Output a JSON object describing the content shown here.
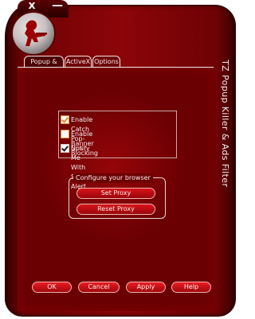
{
  "window": {
    "controls": {
      "close_symbol": "x",
      "minimize_symbol": "—"
    }
  },
  "app": {
    "vertical_title": "TZ Popup Killer & Ads Filter"
  },
  "tabs": [
    {
      "label": "Popup & Ads",
      "active": true
    },
    {
      "label": "ActiveX",
      "active": false
    },
    {
      "label": "Options",
      "active": false
    }
  ],
  "options": [
    {
      "label": "Enable Catch Pop-Ups",
      "checked": true,
      "check_style": "orange"
    },
    {
      "label": "Enable Banner Blocking",
      "checked": false,
      "check_style": "orange"
    },
    {
      "label": "Notify Me With Sound Alert",
      "checked": true,
      "check_style": "white"
    }
  ],
  "browser": {
    "group_title": "Configure your browser",
    "set_proxy": "Set Proxy",
    "reset_proxy": "Reset Proxy"
  },
  "buttons": {
    "ok": "OK",
    "cancel": "Cancel",
    "apply": "Apply",
    "help": "Help"
  },
  "colors": {
    "skin": "#8c0508",
    "content_bg": "#6b0002",
    "button": "#d9141a",
    "text": "#f7efef",
    "check_accent": "#e08b2f"
  },
  "icons": {
    "logo": "counter-strike-soldier-icon",
    "close": "close-icon",
    "minimize": "minimize-icon"
  }
}
